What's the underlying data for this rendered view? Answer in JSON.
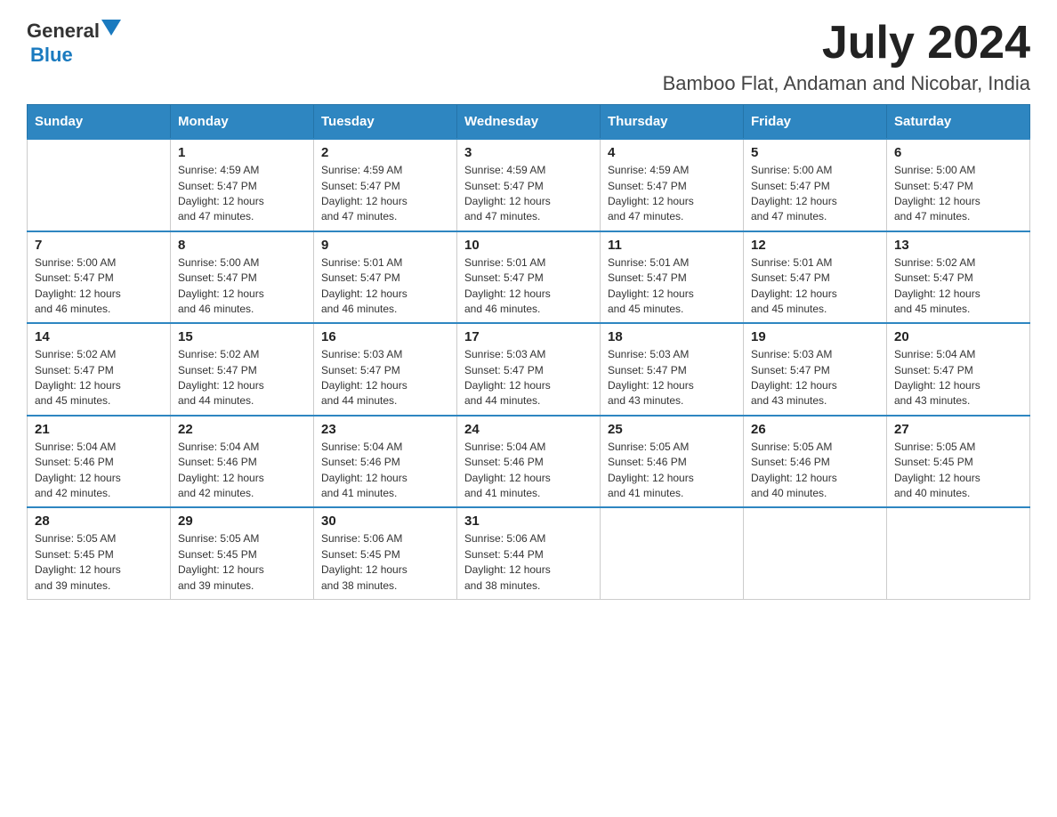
{
  "header": {
    "logo_general": "General",
    "logo_blue": "Blue",
    "month_title": "July 2024",
    "location": "Bamboo Flat, Andaman and Nicobar, India"
  },
  "days_of_week": [
    "Sunday",
    "Monday",
    "Tuesday",
    "Wednesday",
    "Thursday",
    "Friday",
    "Saturday"
  ],
  "weeks": [
    [
      {
        "day": "",
        "info": ""
      },
      {
        "day": "1",
        "info": "Sunrise: 4:59 AM\nSunset: 5:47 PM\nDaylight: 12 hours\nand 47 minutes."
      },
      {
        "day": "2",
        "info": "Sunrise: 4:59 AM\nSunset: 5:47 PM\nDaylight: 12 hours\nand 47 minutes."
      },
      {
        "day": "3",
        "info": "Sunrise: 4:59 AM\nSunset: 5:47 PM\nDaylight: 12 hours\nand 47 minutes."
      },
      {
        "day": "4",
        "info": "Sunrise: 4:59 AM\nSunset: 5:47 PM\nDaylight: 12 hours\nand 47 minutes."
      },
      {
        "day": "5",
        "info": "Sunrise: 5:00 AM\nSunset: 5:47 PM\nDaylight: 12 hours\nand 47 minutes."
      },
      {
        "day": "6",
        "info": "Sunrise: 5:00 AM\nSunset: 5:47 PM\nDaylight: 12 hours\nand 47 minutes."
      }
    ],
    [
      {
        "day": "7",
        "info": "Sunrise: 5:00 AM\nSunset: 5:47 PM\nDaylight: 12 hours\nand 46 minutes."
      },
      {
        "day": "8",
        "info": "Sunrise: 5:00 AM\nSunset: 5:47 PM\nDaylight: 12 hours\nand 46 minutes."
      },
      {
        "day": "9",
        "info": "Sunrise: 5:01 AM\nSunset: 5:47 PM\nDaylight: 12 hours\nand 46 minutes."
      },
      {
        "day": "10",
        "info": "Sunrise: 5:01 AM\nSunset: 5:47 PM\nDaylight: 12 hours\nand 46 minutes."
      },
      {
        "day": "11",
        "info": "Sunrise: 5:01 AM\nSunset: 5:47 PM\nDaylight: 12 hours\nand 45 minutes."
      },
      {
        "day": "12",
        "info": "Sunrise: 5:01 AM\nSunset: 5:47 PM\nDaylight: 12 hours\nand 45 minutes."
      },
      {
        "day": "13",
        "info": "Sunrise: 5:02 AM\nSunset: 5:47 PM\nDaylight: 12 hours\nand 45 minutes."
      }
    ],
    [
      {
        "day": "14",
        "info": "Sunrise: 5:02 AM\nSunset: 5:47 PM\nDaylight: 12 hours\nand 45 minutes."
      },
      {
        "day": "15",
        "info": "Sunrise: 5:02 AM\nSunset: 5:47 PM\nDaylight: 12 hours\nand 44 minutes."
      },
      {
        "day": "16",
        "info": "Sunrise: 5:03 AM\nSunset: 5:47 PM\nDaylight: 12 hours\nand 44 minutes."
      },
      {
        "day": "17",
        "info": "Sunrise: 5:03 AM\nSunset: 5:47 PM\nDaylight: 12 hours\nand 44 minutes."
      },
      {
        "day": "18",
        "info": "Sunrise: 5:03 AM\nSunset: 5:47 PM\nDaylight: 12 hours\nand 43 minutes."
      },
      {
        "day": "19",
        "info": "Sunrise: 5:03 AM\nSunset: 5:47 PM\nDaylight: 12 hours\nand 43 minutes."
      },
      {
        "day": "20",
        "info": "Sunrise: 5:04 AM\nSunset: 5:47 PM\nDaylight: 12 hours\nand 43 minutes."
      }
    ],
    [
      {
        "day": "21",
        "info": "Sunrise: 5:04 AM\nSunset: 5:46 PM\nDaylight: 12 hours\nand 42 minutes."
      },
      {
        "day": "22",
        "info": "Sunrise: 5:04 AM\nSunset: 5:46 PM\nDaylight: 12 hours\nand 42 minutes."
      },
      {
        "day": "23",
        "info": "Sunrise: 5:04 AM\nSunset: 5:46 PM\nDaylight: 12 hours\nand 41 minutes."
      },
      {
        "day": "24",
        "info": "Sunrise: 5:04 AM\nSunset: 5:46 PM\nDaylight: 12 hours\nand 41 minutes."
      },
      {
        "day": "25",
        "info": "Sunrise: 5:05 AM\nSunset: 5:46 PM\nDaylight: 12 hours\nand 41 minutes."
      },
      {
        "day": "26",
        "info": "Sunrise: 5:05 AM\nSunset: 5:46 PM\nDaylight: 12 hours\nand 40 minutes."
      },
      {
        "day": "27",
        "info": "Sunrise: 5:05 AM\nSunset: 5:45 PM\nDaylight: 12 hours\nand 40 minutes."
      }
    ],
    [
      {
        "day": "28",
        "info": "Sunrise: 5:05 AM\nSunset: 5:45 PM\nDaylight: 12 hours\nand 39 minutes."
      },
      {
        "day": "29",
        "info": "Sunrise: 5:05 AM\nSunset: 5:45 PM\nDaylight: 12 hours\nand 39 minutes."
      },
      {
        "day": "30",
        "info": "Sunrise: 5:06 AM\nSunset: 5:45 PM\nDaylight: 12 hours\nand 38 minutes."
      },
      {
        "day": "31",
        "info": "Sunrise: 5:06 AM\nSunset: 5:44 PM\nDaylight: 12 hours\nand 38 minutes."
      },
      {
        "day": "",
        "info": ""
      },
      {
        "day": "",
        "info": ""
      },
      {
        "day": "",
        "info": ""
      }
    ]
  ]
}
